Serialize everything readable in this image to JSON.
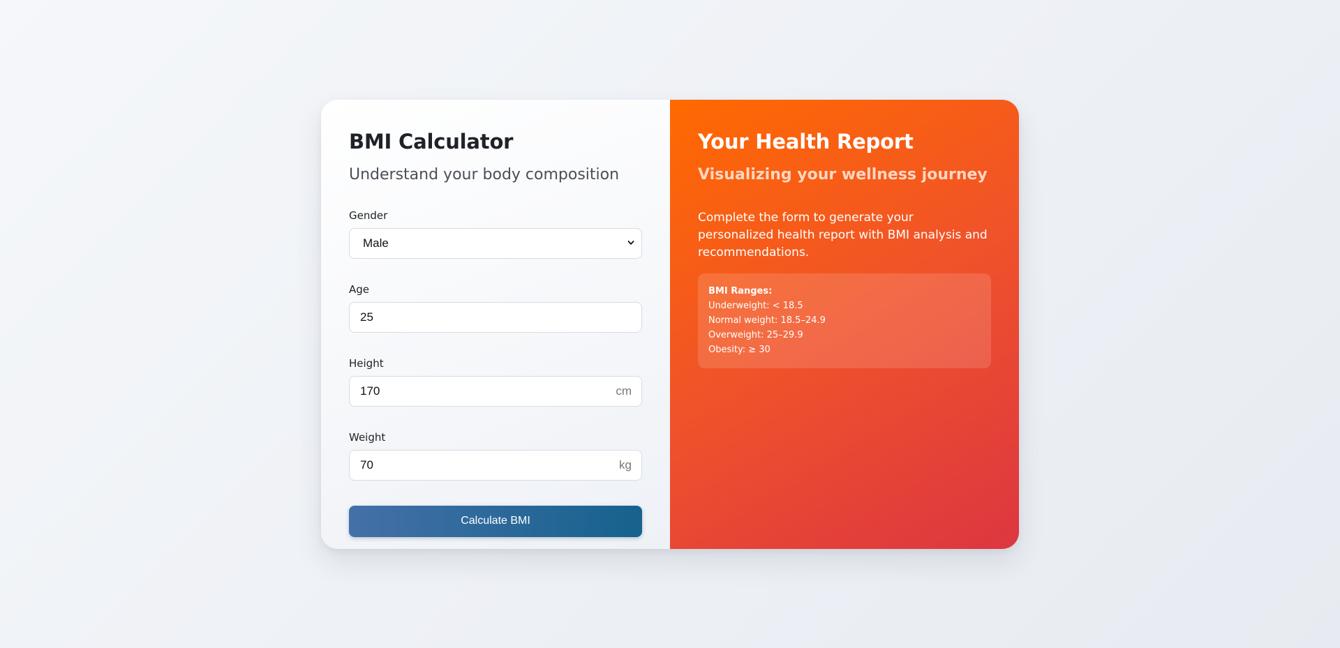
{
  "form": {
    "title": "BMI Calculator",
    "subtitle": "Understand your body composition",
    "gender": {
      "label": "Gender",
      "value": "Male"
    },
    "age": {
      "label": "Age",
      "value": "25"
    },
    "height": {
      "label": "Height",
      "value": "170",
      "unit": "cm"
    },
    "weight": {
      "label": "Weight",
      "value": "70",
      "unit": "kg"
    },
    "submit_label": "Calculate BMI"
  },
  "report": {
    "title": "Your Health Report",
    "subtitle": "Visualizing your wellness journey",
    "description": "Complete the form to generate your personalized health report with BMI analysis and recommendations.",
    "ranges": {
      "title": "BMI Ranges:",
      "items": [
        "Underweight: < 18.5",
        "Normal weight: 18.5–24.9",
        "Overweight: 25–29.9",
        "Obesity: ≥ 30"
      ]
    }
  },
  "colors": {
    "accent_button_start": "#4470a8",
    "accent_button_end": "#16628d",
    "report_gradient_start": "#ff6a00",
    "report_gradient_end": "#dd3641"
  }
}
